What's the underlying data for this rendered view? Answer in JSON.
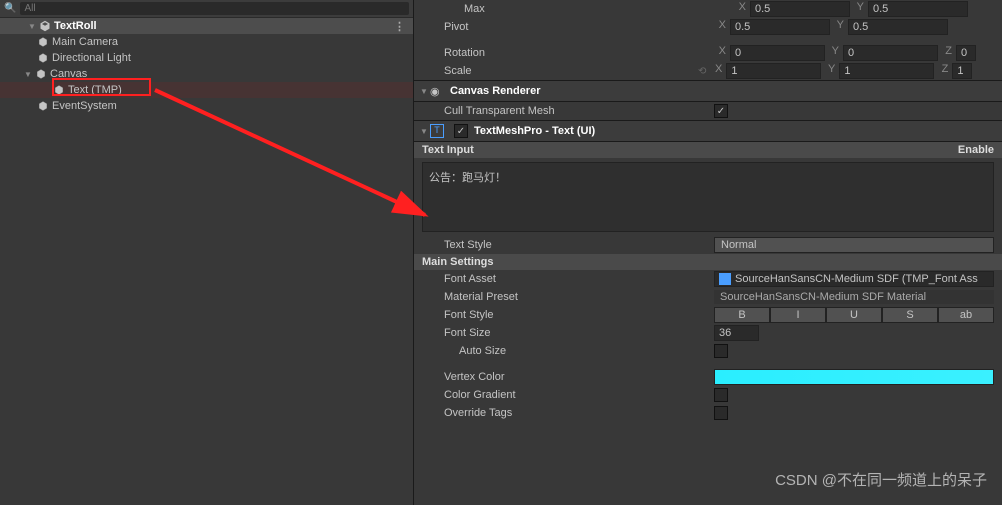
{
  "hierarchy": {
    "search_placeholder": "All",
    "root": "TextRoll",
    "items": [
      {
        "label": "Main Camera"
      },
      {
        "label": "Directional Light"
      },
      {
        "label": "Canvas"
      },
      {
        "label": "Text (TMP)"
      },
      {
        "label": "EventSystem"
      }
    ]
  },
  "transform": {
    "max_label": "Max",
    "max_x": "0.5",
    "max_y": "0.5",
    "pivot_label": "Pivot",
    "pivot_x": "0.5",
    "pivot_y": "0.5",
    "rotation_label": "Rotation",
    "rot_x": "0",
    "rot_y": "0",
    "rot_z": "0",
    "scale_label": "Scale",
    "scale_x": "1",
    "scale_y": "1",
    "scale_z": "1"
  },
  "canvas_renderer": {
    "title": "Canvas Renderer",
    "cull_label": "Cull Transparent Mesh"
  },
  "tmp": {
    "title": "TextMeshPro - Text (UI)",
    "text_input_label": "Text Input",
    "enable_label": "Enable",
    "text_content": "公告：跑马灯！",
    "text_style_label": "Text Style",
    "text_style_value": "Normal",
    "main_settings_label": "Main Settings",
    "font_asset_label": "Font Asset",
    "font_asset_value": "SourceHanSansCN-Medium SDF (TMP_Font Ass",
    "material_preset_label": "Material Preset",
    "material_preset_value": "SourceHanSansCN-Medium SDF Material",
    "font_style_label": "Font Style",
    "styles": [
      "B",
      "I",
      "U",
      "S",
      "ab"
    ],
    "font_size_label": "Font Size",
    "font_size_value": "36",
    "auto_size_label": "Auto Size",
    "vertex_color_label": "Vertex Color",
    "color_gradient_label": "Color Gradient",
    "override_tags_label": "Override Tags"
  },
  "watermark": "CSDN @不在同一频道上的呆子"
}
